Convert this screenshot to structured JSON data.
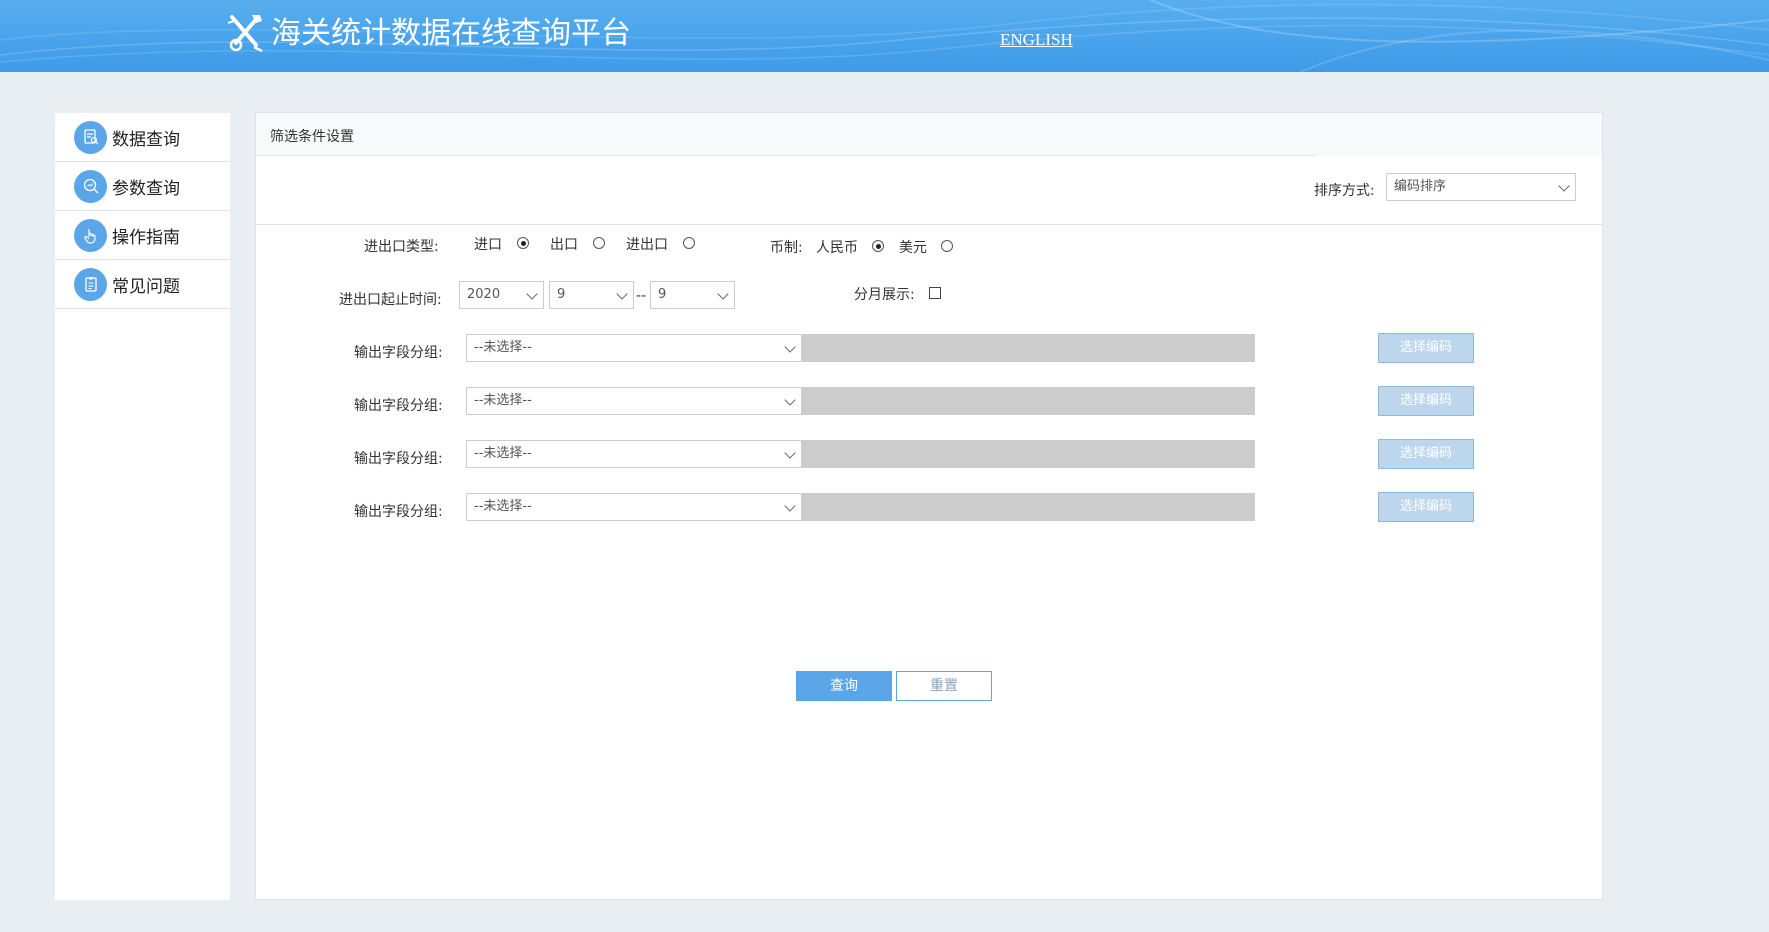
{
  "header": {
    "title": "海关统计数据在线查询平台",
    "english_link": "ENGLISH"
  },
  "sidebar": {
    "items": [
      {
        "label": "数据查询",
        "icon": "document-search-icon"
      },
      {
        "label": "参数查询",
        "icon": "chart-search-icon"
      },
      {
        "label": "操作指南",
        "icon": "hand-pointer-icon"
      },
      {
        "label": "常见问题",
        "icon": "clipboard-icon"
      }
    ]
  },
  "panel": {
    "title": "筛选条件设置",
    "sort_label": "排序方式:",
    "sort_value": "编码排序"
  },
  "form": {
    "trade_type_label": "进出口类型:",
    "trade_options": [
      {
        "label": "进口",
        "checked": true
      },
      {
        "label": "出口",
        "checked": false
      },
      {
        "label": "进出口",
        "checked": false
      }
    ],
    "currency_label": "币制:",
    "currency_options": [
      {
        "label": "人民币",
        "checked": true
      },
      {
        "label": "美元",
        "checked": false
      }
    ],
    "period_label": "进出口起止时间:",
    "year": "2020",
    "month_start": "9",
    "month_end": "9",
    "range_sep": "--",
    "monthly_label": "分月展示:",
    "field_groups": [
      {
        "label": "输出字段分组:",
        "value": "--未选择--",
        "button": "选择编码"
      },
      {
        "label": "输出字段分组:",
        "value": "--未选择--",
        "button": "选择编码"
      },
      {
        "label": "输出字段分组:",
        "value": "--未选择--",
        "button": "选择编码"
      },
      {
        "label": "输出字段分组:",
        "value": "--未选择--",
        "button": "选择编码"
      }
    ]
  },
  "actions": {
    "query": "查询",
    "reset": "重置"
  },
  "colors": {
    "header": "#3d9be8",
    "accent": "#5aa6e8",
    "background": "#e9eef2"
  }
}
